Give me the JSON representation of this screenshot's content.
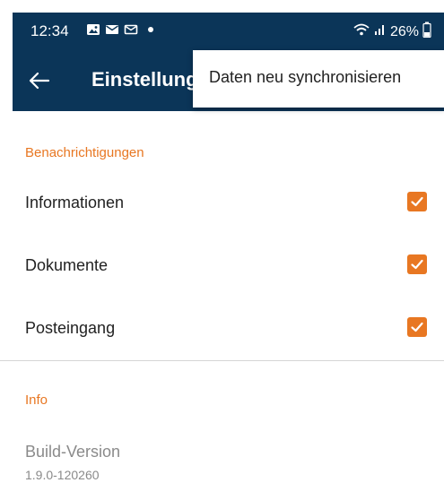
{
  "status_bar": {
    "time": "12:34",
    "battery": "26%",
    "icons": [
      "gallery-icon",
      "mail-icon",
      "mail-outline-icon",
      "dot-icon",
      "wifi-icon",
      "signal-icon",
      "battery-icon"
    ]
  },
  "app_bar": {
    "title": "Einstellungen",
    "back_icon": "back-arrow-icon",
    "color": "#0b3558"
  },
  "overflow_menu": {
    "items": [
      {
        "label": "Daten neu synchronisieren"
      }
    ]
  },
  "notifications_section": {
    "header": "Benachrichtigungen",
    "items": [
      {
        "label": "Informationen",
        "checked": true
      },
      {
        "label": "Dokumente",
        "checked": true
      },
      {
        "label": "Posteingang",
        "checked": true
      }
    ]
  },
  "info_section": {
    "header": "Info",
    "build_label": "Build-Version",
    "build_value": "1.9.0-120260"
  },
  "colors": {
    "accent": "#e87722",
    "primary": "#0b3558",
    "text": "#222222",
    "muted": "#8a8a8a"
  }
}
